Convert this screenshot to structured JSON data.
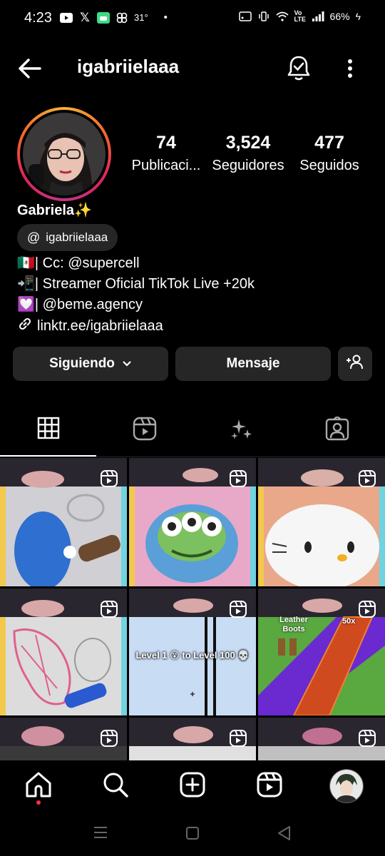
{
  "status_bar": {
    "time": "4:23",
    "temperature": "31°",
    "battery": "66%",
    "network": "Vo LTE"
  },
  "header": {
    "username": "igabriielaaa"
  },
  "profile": {
    "display_name": "Gabriela✨",
    "threads_handle": "igabriielaaa",
    "stats": [
      {
        "value": "74",
        "label": "Publicaci..."
      },
      {
        "value": "3,524",
        "label": "Seguidores"
      },
      {
        "value": "477",
        "label": "Seguidos"
      }
    ],
    "bio": [
      "🇲🇽| Cc: @supercell",
      "📲| Streamer Oficial TikTok Live +20k",
      "💟| @beme.agency"
    ],
    "link": "linktr.ee/igabriielaaa"
  },
  "actions": {
    "following": "Siguiendo",
    "message": "Mensaje"
  },
  "tabs": [
    "posts-grid",
    "reels",
    "ai",
    "tagged"
  ],
  "grid_overlays": {
    "level_text": "Level 1 😮 to Level 100 💀",
    "leather_text": "Leather Boots",
    "multiplier": "50x"
  },
  "colors": {
    "background": "#000000",
    "button_bg": "#262626",
    "notification_dot": "#ff3040"
  }
}
